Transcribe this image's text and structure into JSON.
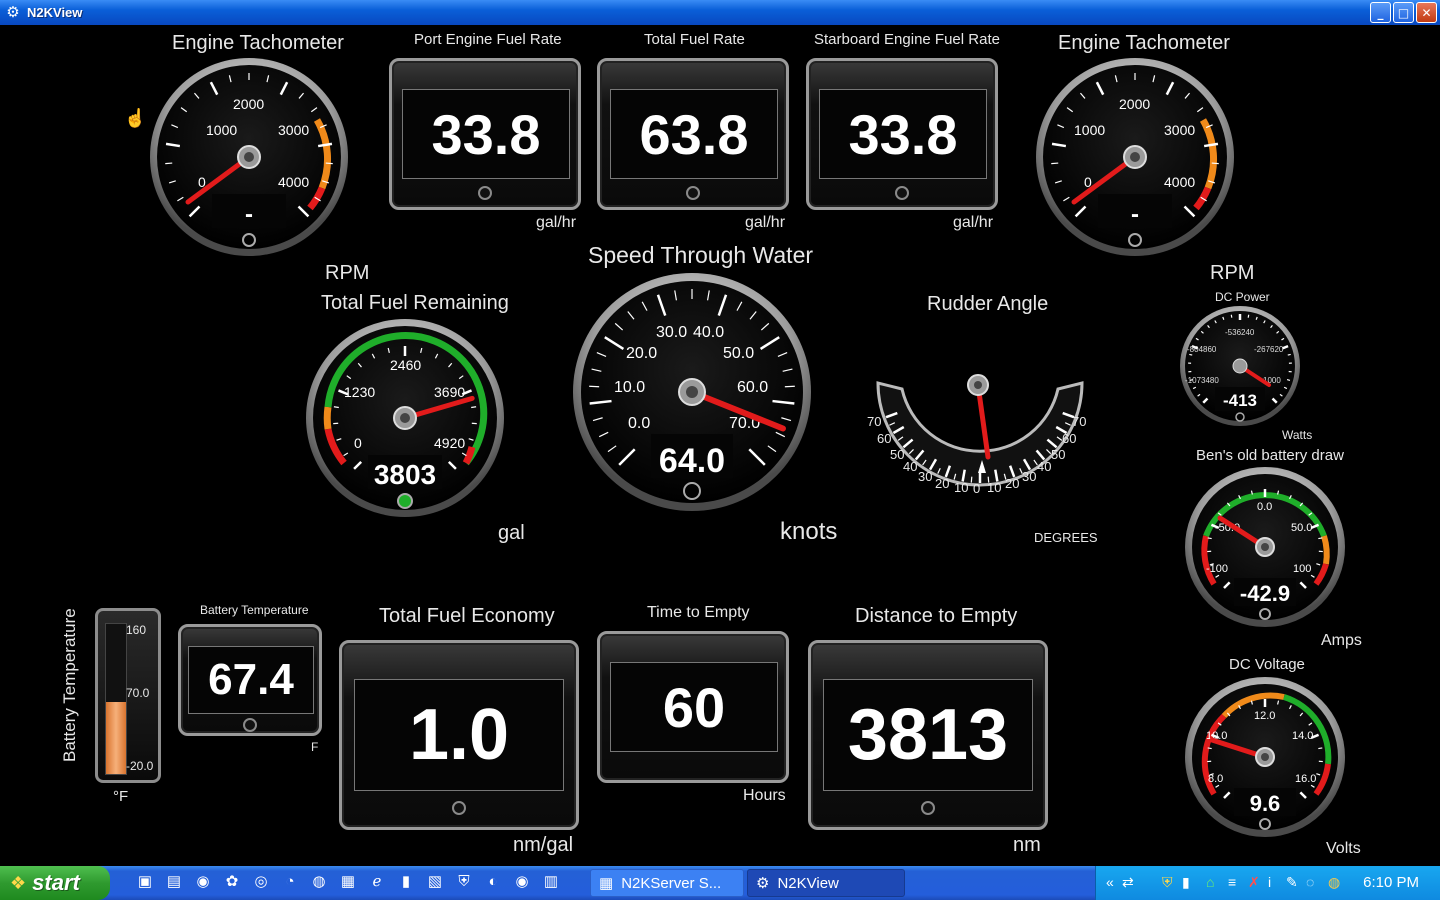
{
  "window": {
    "title": "N2KView",
    "buttons": [
      "_",
      "□",
      "✕"
    ]
  },
  "gauges": {
    "tach_port": {
      "title": "Engine Tachometer",
      "ticks": [
        "0",
        "1000",
        "2000",
        "3000",
        "4000"
      ],
      "readout": "-",
      "unit": "RPM",
      "rpm": 0
    },
    "tach_stbd": {
      "title": "Engine Tachometer",
      "ticks": [
        "0",
        "1000",
        "2000",
        "3000",
        "4000"
      ],
      "readout": "-",
      "unit": "RPM",
      "rpm": 0
    },
    "fuel_remaining": {
      "title": "Total Fuel Remaining",
      "ticks": [
        "0",
        "1230",
        "2460",
        "3690",
        "4920"
      ],
      "readout": "3803",
      "unit": "gal",
      "value": 3803,
      "max": 4920
    },
    "speed": {
      "title": "Speed Through Water",
      "ticks": [
        "0.0",
        "10.0",
        "20.0",
        "30.0",
        "40.0",
        "50.0",
        "60.0",
        "70.0"
      ],
      "readout": "64.0",
      "unit": "knots",
      "value": 64.0,
      "max": 70
    },
    "rudder": {
      "title": "Rudder Angle",
      "ticks_left": [
        "70",
        "60",
        "50",
        "40",
        "30",
        "20",
        "10"
      ],
      "ticks_right": [
        "0",
        "10",
        "20",
        "30",
        "40",
        "50",
        "60",
        "70"
      ],
      "unit": "DEGREES",
      "angle": 5
    },
    "dc_power": {
      "title": "DC Power",
      "ticks": [
        "-1073480",
        "-804860",
        "-536240",
        "-267620",
        "1000"
      ],
      "readout": "-413",
      "unit": "Watts"
    },
    "battery_draw": {
      "title": "Ben's old battery draw",
      "ticks": [
        "-100",
        "-50.0",
        "0.0",
        "50.0",
        "100"
      ],
      "readout": "-42.9",
      "unit": "Amps",
      "value": -42.9
    },
    "dc_voltage": {
      "title": "DC Voltage",
      "ticks": [
        "8.0",
        "10.0",
        "12.0",
        "14.0",
        "16.0"
      ],
      "readout": "9.6",
      "unit": "Volts",
      "value": 9.6
    }
  },
  "digital": {
    "port_fuel": {
      "title": "Port Engine Fuel Rate",
      "value": "33.8",
      "unit": "gal/hr"
    },
    "total_fuel": {
      "title": "Total Fuel Rate",
      "value": "63.8",
      "unit": "gal/hr"
    },
    "stbd_fuel": {
      "title": "Starboard Engine Fuel Rate",
      "value": "33.8",
      "unit": "gal/hr"
    },
    "battery_temp": {
      "title": "Battery Temperature",
      "value": "67.4",
      "unit": "F"
    },
    "fuel_economy": {
      "title": "Total Fuel Economy",
      "value": "1.0",
      "unit": "nm/gal"
    },
    "time_to_empty": {
      "title": "Time to Empty",
      "value": "60",
      "unit": "Hours"
    },
    "distance_to_empty": {
      "title": "Distance to Empty",
      "value": "3813",
      "unit": "nm"
    }
  },
  "thermometer": {
    "title": "Battery Temperature",
    "ticks": [
      "160",
      "70.0",
      "-20.0"
    ],
    "unit": "°F",
    "fill_fraction": 0.48
  },
  "taskbar": {
    "start": "start",
    "tasks": [
      "N2KServer S...",
      "N2KView"
    ],
    "clock": "6:10 PM",
    "quicklaunch_icons": [
      "desktop-icon",
      "folder-icon",
      "firefox-icon",
      "tool-icon",
      "media-icon",
      "eye-icon",
      "globe-icon",
      "network-icon",
      "ie-icon",
      "terminal-icon",
      "note-icon",
      "shield-icon",
      "search-icon",
      "firefox-icon",
      "monitor-icon"
    ]
  },
  "colors": {
    "titlebar": "#0a5fd8",
    "needle": "#e21b1b",
    "green_band": "#1fae2a",
    "orange_band": "#f08a1a",
    "red_band": "#e21b1b"
  }
}
